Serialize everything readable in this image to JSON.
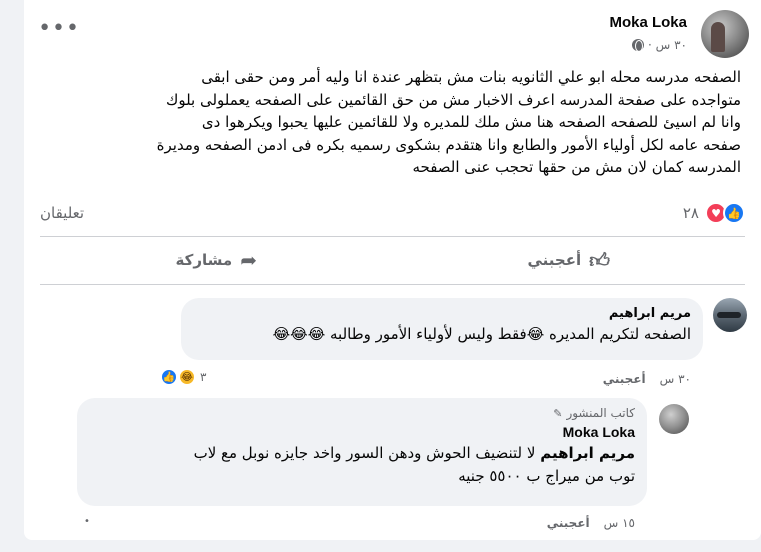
{
  "post": {
    "author": "Moka Loka",
    "time": "٣٠ س ·",
    "body_lines": [
      "الصفحه مدرسه محله ابو علي الثانويه  بنات مش بتظهر عندة  انا وليه أمر ومن حقى ابقى",
      "متواجده على صفحة المدرسه اعرف الاخبار مش من حق القائمين على الصفحه يعملولى بلوك",
      "وانا لم اسيئ للصفحه الصفحه هنا مش ملك للمديره ولا للقائمين عليها يحبوا ويكرهوا دى",
      "صفحه عامه لكل أولياء الأمور والطابع وانا هتقدم بشكوى رسميه بكره فى ادمن الصفحه ومديرة",
      "المدرسه كمان لان مش من حقها تحجب عنى الصفحه"
    ],
    "reaction_count": "٢٨",
    "comments_label": "تعليقان",
    "like_label": "أعجبني",
    "share_label": "مشاركة"
  },
  "comments": [
    {
      "name": "مريم ابراهيم",
      "text": "الصفحه لتكريم المديره 😂فقط وليس لأولياء الأمور وطالبه 😂😂😂",
      "time": "٣٠ س",
      "like_label": "أعجبني",
      "reaction_count": "٣"
    },
    {
      "badge": "كاتب المنشور",
      "name": "Moka Loka",
      "mention": "مريم ابراهيم",
      "text_lines": [
        "لا لتنضيف الحوش ودهن السور واخد جايزه نوبل مع لاب",
        "توب من ميراج ب ٥٥٠٠ جنيه"
      ],
      "time": "١٥ س",
      "like_label": "أعجبني"
    }
  ],
  "icons": {
    "more": "more-dots-icon",
    "globe": "globe-icon",
    "like": "like-thumb-icon",
    "share": "share-arrow-icon",
    "haha": "haha-emoji-icon"
  },
  "colors": {
    "like_blue": "#1877f2",
    "love_red": "#f33e58",
    "haha_yellow": "#f7b928"
  }
}
